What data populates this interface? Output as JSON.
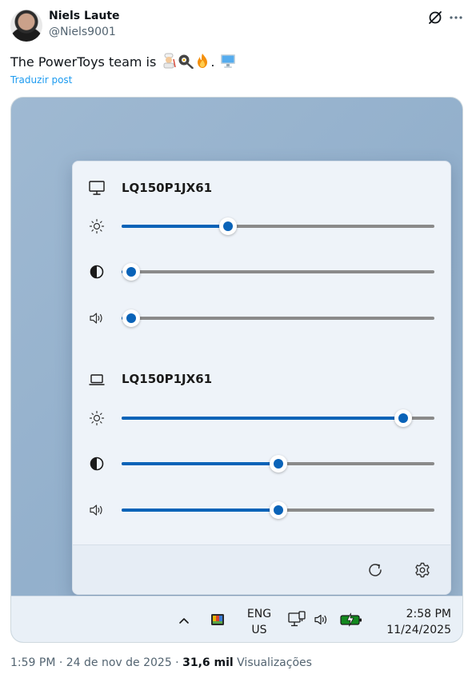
{
  "author": {
    "name": "Niels Laute",
    "handle": "@Niels9001"
  },
  "tweet": {
    "text": "The PowerToys team is ",
    "emoji": [
      "cook",
      "frying-pan",
      "fire",
      "dot",
      "monitor"
    ],
    "period": ".",
    "translate_label": "Traduzir post"
  },
  "flyout": {
    "monitors": [
      {
        "name": "LQ150P1JX61",
        "icon": "desktop-monitor-icon",
        "brightness": 0.34,
        "contrast": 0.03,
        "volume": 0.03
      },
      {
        "name": "LQ150P1JX61",
        "icon": "laptop-icon",
        "brightness": 0.9,
        "contrast": 0.5,
        "volume": 0.5
      }
    ],
    "accent": "#0a63b8"
  },
  "taskbar": {
    "lang_line1": "ENG",
    "lang_line2": "US",
    "time": "2:58 PM",
    "date": "11/24/2025"
  },
  "meta": {
    "time": "1:59 PM · 24 de nov de 2025 · ",
    "views_count": "31,6 mil",
    "views_label": " Visualizações"
  }
}
